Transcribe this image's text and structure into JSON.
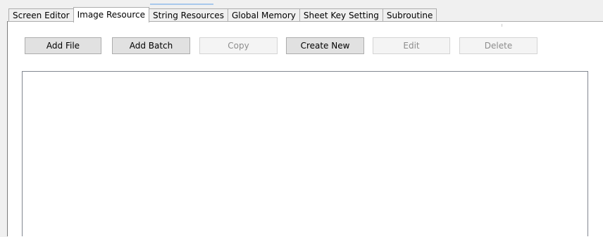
{
  "tabs": [
    {
      "label": "Screen Editor",
      "active": false
    },
    {
      "label": "Image Resource",
      "active": true
    },
    {
      "label": "String Resources",
      "active": false
    },
    {
      "label": "Global Memory",
      "active": false
    },
    {
      "label": "Sheet Key Setting",
      "active": false
    },
    {
      "label": "Subroutine",
      "active": false
    }
  ],
  "toolbar": {
    "add_file": "Add File",
    "add_batch": "Add Batch",
    "copy": "Copy",
    "create_new": "Create New",
    "edit": "Edit",
    "delete": "Delete"
  },
  "states": {
    "add_file": "enabled",
    "add_batch": "enabled",
    "copy": "disabled",
    "create_new": "enabled",
    "edit": "disabled",
    "delete": "disabled"
  },
  "colors": {
    "window_bg": "#f0f0f0",
    "panel_bg": "#ffffff",
    "button_face": "#e1e1e1",
    "button_border": "#adadad",
    "disabled_text": "#8d8d8d",
    "tab_accent": "#a8c8ec"
  }
}
